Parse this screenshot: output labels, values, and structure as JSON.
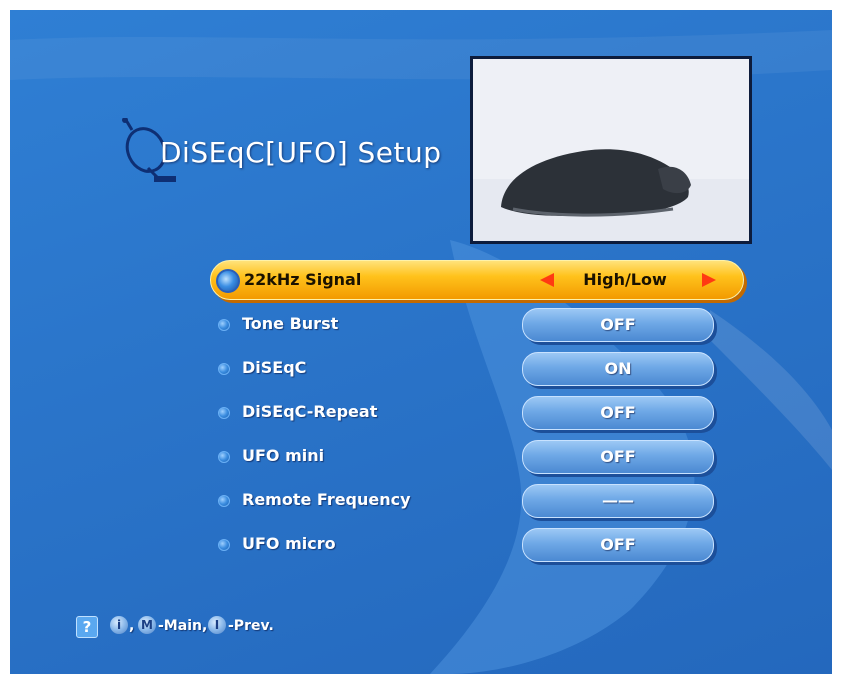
{
  "title": "DiSEqC[UFO] Setup",
  "colors": {
    "background": "#2a74c9",
    "highlight": "#ffc21c",
    "arrow": "#ff3a12",
    "pill": "#6ea8e6"
  },
  "menu": {
    "items": [
      {
        "label": "22kHz Signal",
        "value": "High/Low",
        "selected": true
      },
      {
        "label": "Tone Burst",
        "value": "OFF"
      },
      {
        "label": "DiSEqC",
        "value": "ON"
      },
      {
        "label": "DiSEqC-Repeat",
        "value": "OFF"
      },
      {
        "label": "UFO mini",
        "value": "OFF"
      },
      {
        "label": "Remote Frequency",
        "value": "——"
      },
      {
        "label": "UFO micro",
        "value": "OFF"
      }
    ]
  },
  "footer": {
    "help_glyph": "?",
    "info_glyph": "i",
    "main_glyph": "M",
    "prev_glyph": "I",
    "main_text": "-Main,",
    "prev_text": "-Prev.",
    "comma": ","
  },
  "icons": {
    "title_icon": "satellite-dish-icon",
    "help_icon": "help-icon",
    "left_arrow": "arrow-left-icon",
    "right_arrow": "arrow-right-icon"
  }
}
